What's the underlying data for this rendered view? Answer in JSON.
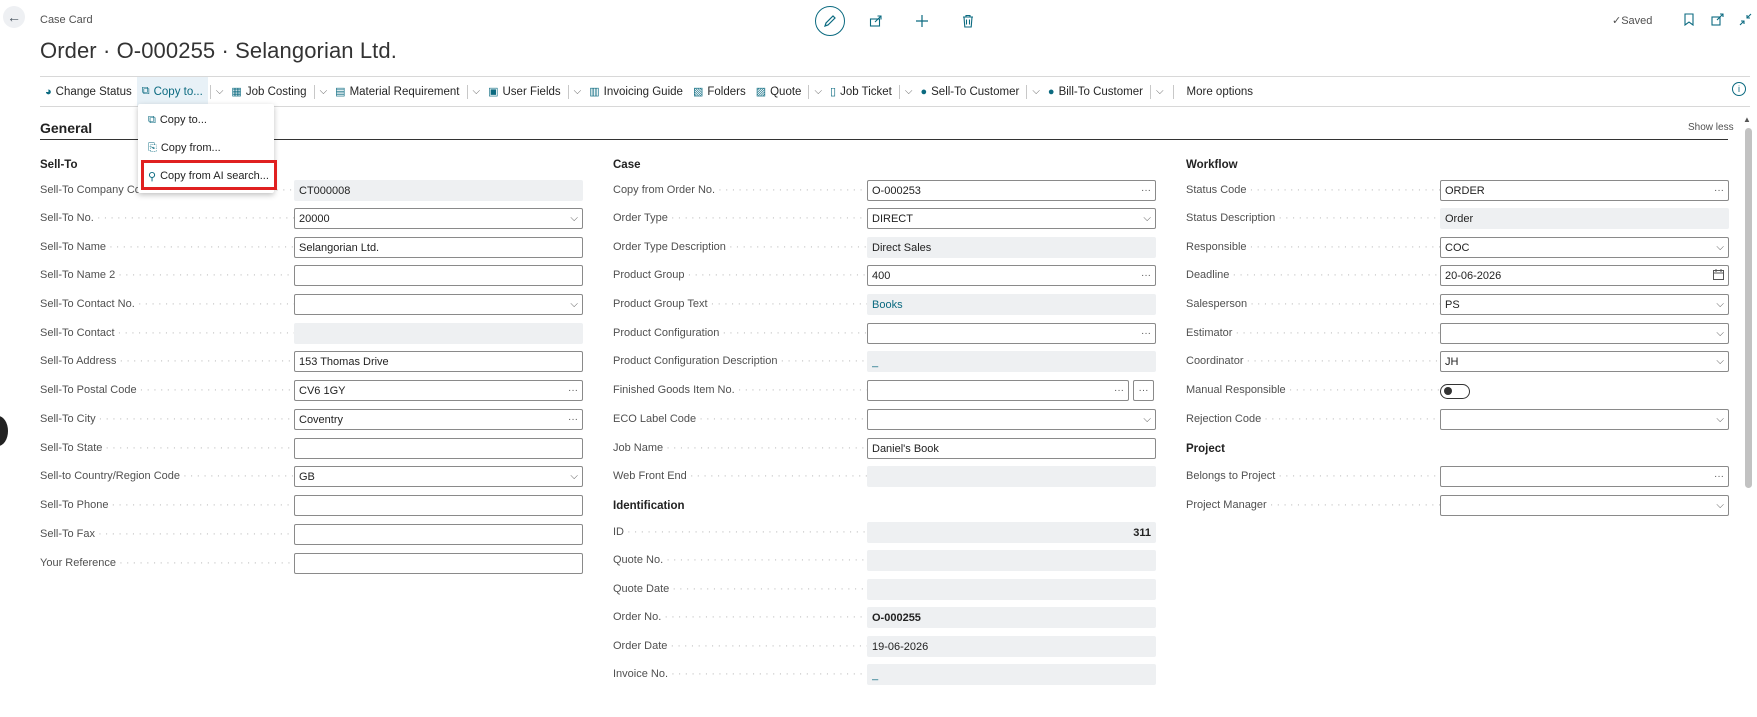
{
  "header": {
    "page_type": "Case Card",
    "title": "Order · O-000255 · Selangorian Ltd.",
    "saved": "Saved"
  },
  "actions": [
    {
      "label": "Change Status",
      "icon": "change-status-icon",
      "chevron": false
    },
    {
      "label": "Copy to...",
      "icon": "copy-icon",
      "chevron": true
    },
    {
      "label": "Job Costing",
      "icon": "job-costing-icon",
      "chevron": true
    },
    {
      "label": "Material Requirement",
      "icon": "material-icon",
      "chevron": true
    },
    {
      "label": "User Fields",
      "icon": "user-fields-icon",
      "chevron": true
    },
    {
      "label": "Invoicing Guide",
      "icon": "invoice-icon",
      "chevron": false
    },
    {
      "label": "Folders",
      "icon": "folder-icon",
      "chevron": false
    },
    {
      "label": "Quote",
      "icon": "quote-icon",
      "chevron": true
    },
    {
      "label": "Job Ticket",
      "icon": "job-ticket-icon",
      "chevron": true
    },
    {
      "label": "Sell-To Customer",
      "icon": "person-icon",
      "chevron": true
    },
    {
      "label": "Bill-To Customer",
      "icon": "person-icon",
      "chevron": true
    },
    {
      "label": "More options",
      "icon": "",
      "chevron": false
    }
  ],
  "dropdown": {
    "items": [
      "Copy to...",
      "Copy from...",
      "Copy from AI search..."
    ]
  },
  "section": {
    "title": "General",
    "show_less": "Show less"
  },
  "sell_to": {
    "heading": "Sell-To",
    "fields": [
      {
        "label": "Sell-To Company Contact",
        "value": "CT000008"
      },
      {
        "label": "Sell-To No.",
        "value": "20000"
      },
      {
        "label": "Sell-To Name",
        "value": "Selangorian Ltd."
      },
      {
        "label": "Sell-To Name 2",
        "value": ""
      },
      {
        "label": "Sell-To Contact No.",
        "value": ""
      },
      {
        "label": "Sell-To Contact",
        "value": ""
      },
      {
        "label": "Sell-To Address",
        "value": "153 Thomas Drive"
      },
      {
        "label": "Sell-To Postal Code",
        "value": "CV6 1GY"
      },
      {
        "label": "Sell-To City",
        "value": "Coventry"
      },
      {
        "label": "Sell-To State",
        "value": ""
      },
      {
        "label": "Sell-to Country/Region Code",
        "value": "GB"
      },
      {
        "label": "Sell-To Phone",
        "value": ""
      },
      {
        "label": "Sell-To Fax",
        "value": ""
      },
      {
        "label": "Your Reference",
        "value": ""
      }
    ]
  },
  "case": {
    "heading": "Case",
    "fields": [
      {
        "label": "Copy from Order No.",
        "value": "O-000253"
      },
      {
        "label": "Order Type",
        "value": "DIRECT"
      },
      {
        "label": "Order Type Description",
        "value": "Direct Sales"
      },
      {
        "label": "Product Group",
        "value": "400"
      },
      {
        "label": "Product Group Text",
        "value": "Books"
      },
      {
        "label": "Product Configuration",
        "value": ""
      },
      {
        "label": "Product Configuration Description",
        "value": "_"
      },
      {
        "label": "Finished Goods Item No.",
        "value": ""
      },
      {
        "label": "ECO Label Code",
        "value": ""
      },
      {
        "label": "Job Name",
        "value": "Daniel's Book"
      },
      {
        "label": "Web Front End",
        "value": ""
      }
    ]
  },
  "identification": {
    "heading": "Identification",
    "fields": [
      {
        "label": "ID",
        "value": "311"
      },
      {
        "label": "Quote No.",
        "value": ""
      },
      {
        "label": "Quote Date",
        "value": ""
      },
      {
        "label": "Order No.",
        "value": "O-000255"
      },
      {
        "label": "Order Date",
        "value": "19-06-2026"
      },
      {
        "label": "Invoice No.",
        "value": "_"
      }
    ]
  },
  "workflow": {
    "heading": "Workflow",
    "fields": [
      {
        "label": "Status Code",
        "value": "ORDER"
      },
      {
        "label": "Status Description",
        "value": "Order"
      },
      {
        "label": "Responsible",
        "value": "COC"
      },
      {
        "label": "Deadline",
        "value": "20-06-2026"
      },
      {
        "label": "Salesperson",
        "value": "PS"
      },
      {
        "label": "Estimator",
        "value": ""
      },
      {
        "label": "Coordinator",
        "value": "JH"
      },
      {
        "label": "Manual Responsible",
        "value": ""
      },
      {
        "label": "Rejection Code",
        "value": ""
      }
    ]
  },
  "project": {
    "heading": "Project",
    "fields": [
      {
        "label": "Belongs to Project",
        "value": ""
      },
      {
        "label": "Project Manager",
        "value": ""
      }
    ]
  }
}
